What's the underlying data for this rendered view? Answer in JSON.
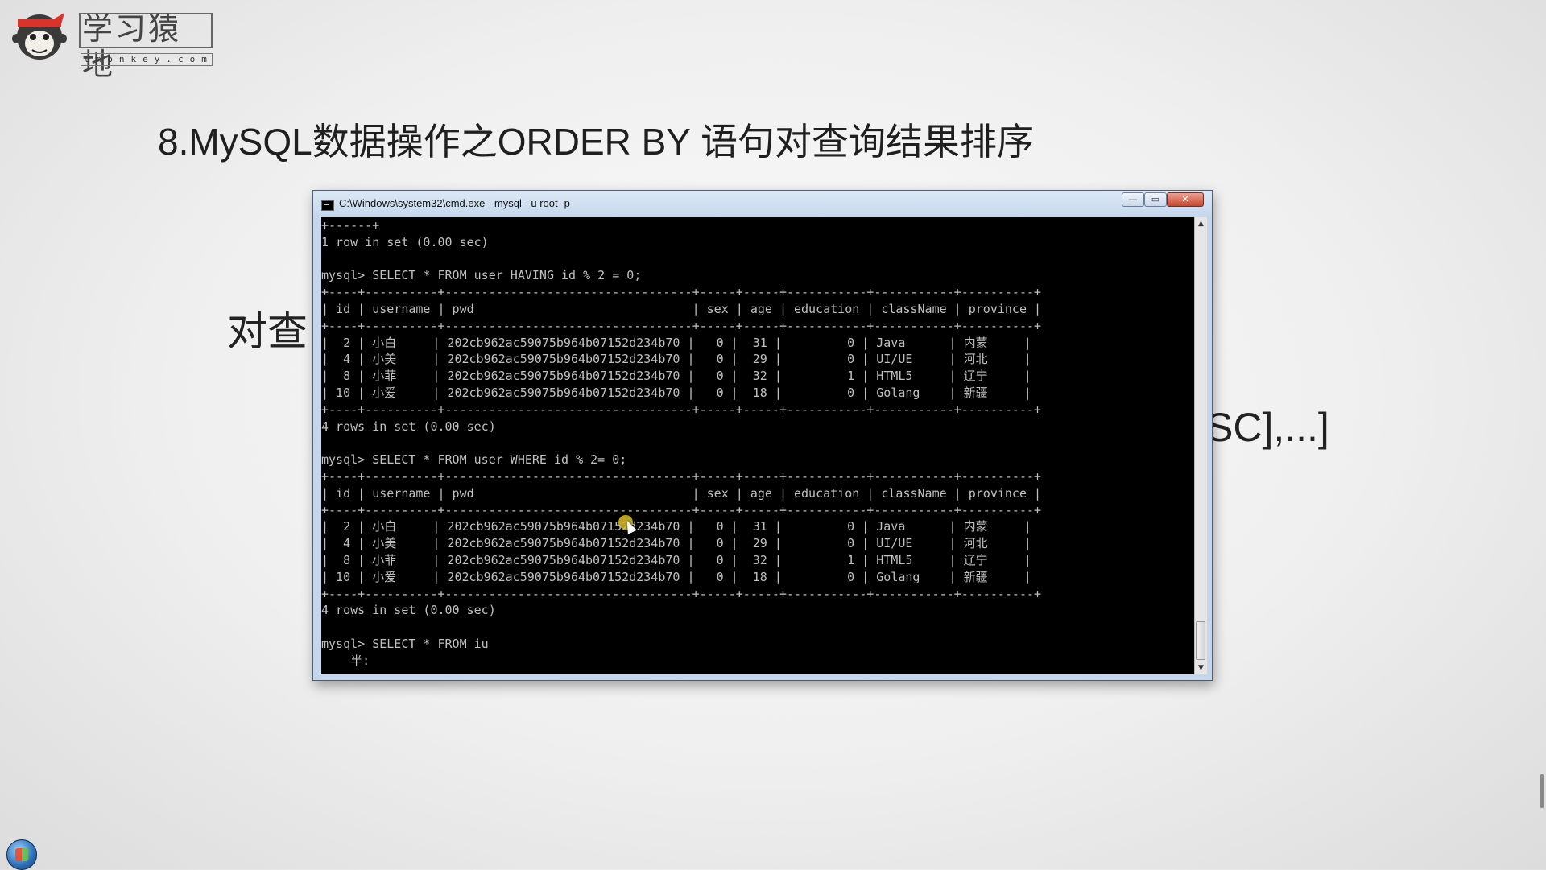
{
  "logo": {
    "brand_cn": "学习猿地",
    "brand_url": "lmonkey.com",
    "icon": "monkey-logo-icon"
  },
  "slide": {
    "title": "8.MySQL数据操作之ORDER BY 语句对查询结果排序",
    "bg_text_left": "对查",
    "bg_text_right": "SC],...]"
  },
  "window": {
    "title": "C:\\Windows\\system32\\cmd.exe - mysql  -u root -p",
    "minimize_label": "—",
    "maximize_label": "▭",
    "close_label": "✕"
  },
  "console": {
    "lines": [
      "+------+",
      "1 row in set (0.00 sec)",
      "",
      "mysql> SELECT * FROM user HAVING id % 2 = 0;",
      "+----+----------+----------------------------------+-----+-----+-----------+-----------+----------+",
      "| id | username | pwd                              | sex | age | education | className | province |",
      "+----+----------+----------------------------------+-----+-----+-----------+-----------+----------+",
      "|  2 | 小白     | 202cb962ac59075b964b07152d234b70 |   0 |  31 |         0 | Java      | 内蒙     |",
      "|  4 | 小美     | 202cb962ac59075b964b07152d234b70 |   0 |  29 |         0 | UI/UE     | 河北     |",
      "|  8 | 小菲     | 202cb962ac59075b964b07152d234b70 |   0 |  32 |         1 | HTML5     | 辽宁     |",
      "| 10 | 小爱     | 202cb962ac59075b964b07152d234b70 |   0 |  18 |         0 | Golang    | 新疆     |",
      "+----+----------+----------------------------------+-----+-----+-----------+-----------+----------+",
      "4 rows in set (0.00 sec)",
      "",
      "mysql> SELECT * FROM user WHERE id % 2= 0;",
      "+----+----------+----------------------------------+-----+-----+-----------+-----------+----------+",
      "| id | username | pwd                              | sex | age | education | className | province |",
      "+----+----------+----------------------------------+-----+-----+-----------+-----------+----------+",
      "|  2 | 小白     | 202cb962ac59075b964b07152d234b70 |   0 |  31 |         0 | Java      | 内蒙     |",
      "|  4 | 小美     | 202cb962ac59075b964b07152d234b70 |   0 |  29 |         0 | UI/UE     | 河北     |",
      "|  8 | 小菲     | 202cb962ac59075b964b07152d234b70 |   0 |  32 |         1 | HTML5     | 辽宁     |",
      "| 10 | 小爱     | 202cb962ac59075b964b07152d234b70 |   0 |  18 |         0 | Golang    | 新疆     |",
      "+----+----------+----------------------------------+-----+-----+-----------+-----------+----------+",
      "4 rows in set (0.00 sec)",
      "",
      "mysql> SELECT * FROM iu",
      "    半:"
    ]
  },
  "taskbar": {
    "start_icon": "windows-start-orb-icon"
  }
}
